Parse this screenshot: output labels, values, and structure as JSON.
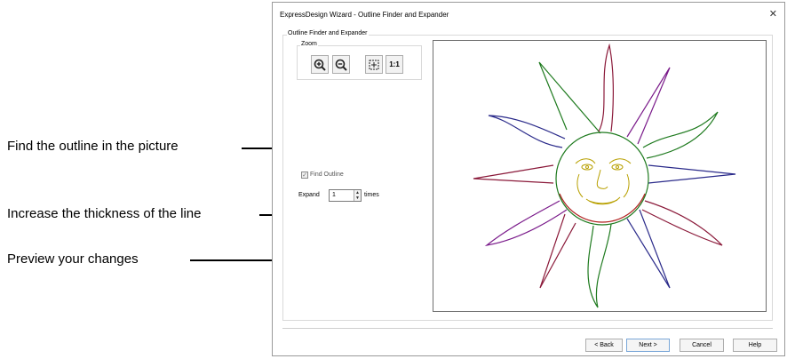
{
  "callouts": {
    "find_outline": "Find the outline in the picture",
    "increase_thickness": "Increase the thickness of the line",
    "preview": "Preview your changes"
  },
  "dialog": {
    "title": "ExpressDesign Wizard - Outline Finder and Expander",
    "close": "✕",
    "group_label": "Outline Finder and Expander",
    "zoom_label": "Zoom",
    "zoom_buttons": {
      "zoom_in": "zoom-in-icon",
      "zoom_out": "zoom-out-icon",
      "fit": "fit-to-window-icon",
      "actual": "1:1"
    },
    "find_outline_label": "Find Outline",
    "find_outline_checked": true,
    "expand_label": "Expand",
    "expand_value": "1",
    "times_label": "times",
    "buttons": {
      "back": "< Back",
      "next": "Next >",
      "cancel": "Cancel",
      "help": "Help"
    }
  },
  "colors": {
    "ray_red": "#8b1a3a",
    "ray_green": "#1e7a1e",
    "ray_blue": "#2a2a8a",
    "ray_purple": "#7a1a8a",
    "face_yellow": "#b8a000"
  }
}
